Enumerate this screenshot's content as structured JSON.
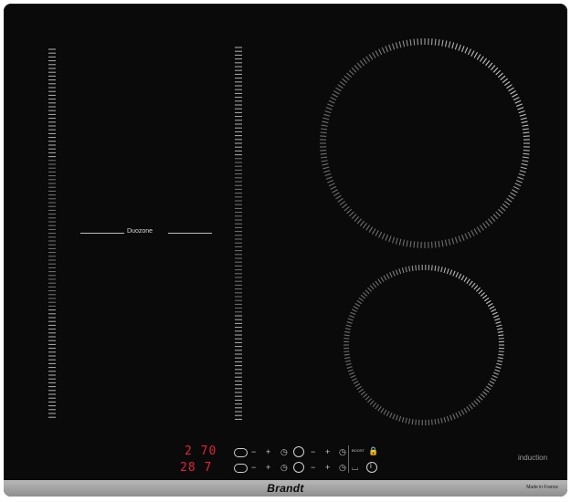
{
  "brand": "Brandt",
  "made_in": "Made in France",
  "induction_label": "induction",
  "duozone_label": "Duozone",
  "displays": {
    "top": "2 70",
    "bottom": "28 7"
  },
  "controls": {
    "minus": "−",
    "plus": "+",
    "timer": "◷",
    "lock": "🔒",
    "info": "i",
    "zone_select": "○",
    "booster": "BOOST"
  },
  "colors": {
    "glass": "#0a0a0b",
    "marks": "#cfcfcf",
    "display": "#e0233b",
    "frame": "#9e9e9e"
  }
}
